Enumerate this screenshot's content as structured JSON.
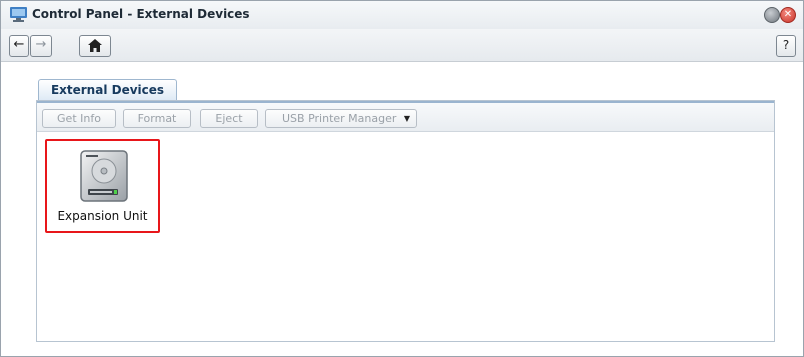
{
  "window": {
    "title": "Control Panel - External Devices",
    "close_glyph": "✕"
  },
  "nav": {
    "back_glyph": "←",
    "forward_glyph": "→",
    "home_glyph": "⌂",
    "help_label": "?"
  },
  "tabs": [
    {
      "label": "External Devices",
      "active": true
    }
  ],
  "toolbar": {
    "get_info": "Get Info",
    "format": "Format",
    "eject": "Eject",
    "usb_printer_manager": "USB Printer Manager",
    "dropdown_glyph": "▼"
  },
  "devices": [
    {
      "label": "Expansion Unit",
      "icon": "hard-drive-icon",
      "selected": true
    }
  ],
  "colors": {
    "selection_border": "#e8161a",
    "tab_text": "#173a5e",
    "close_button": "#c9342a"
  }
}
